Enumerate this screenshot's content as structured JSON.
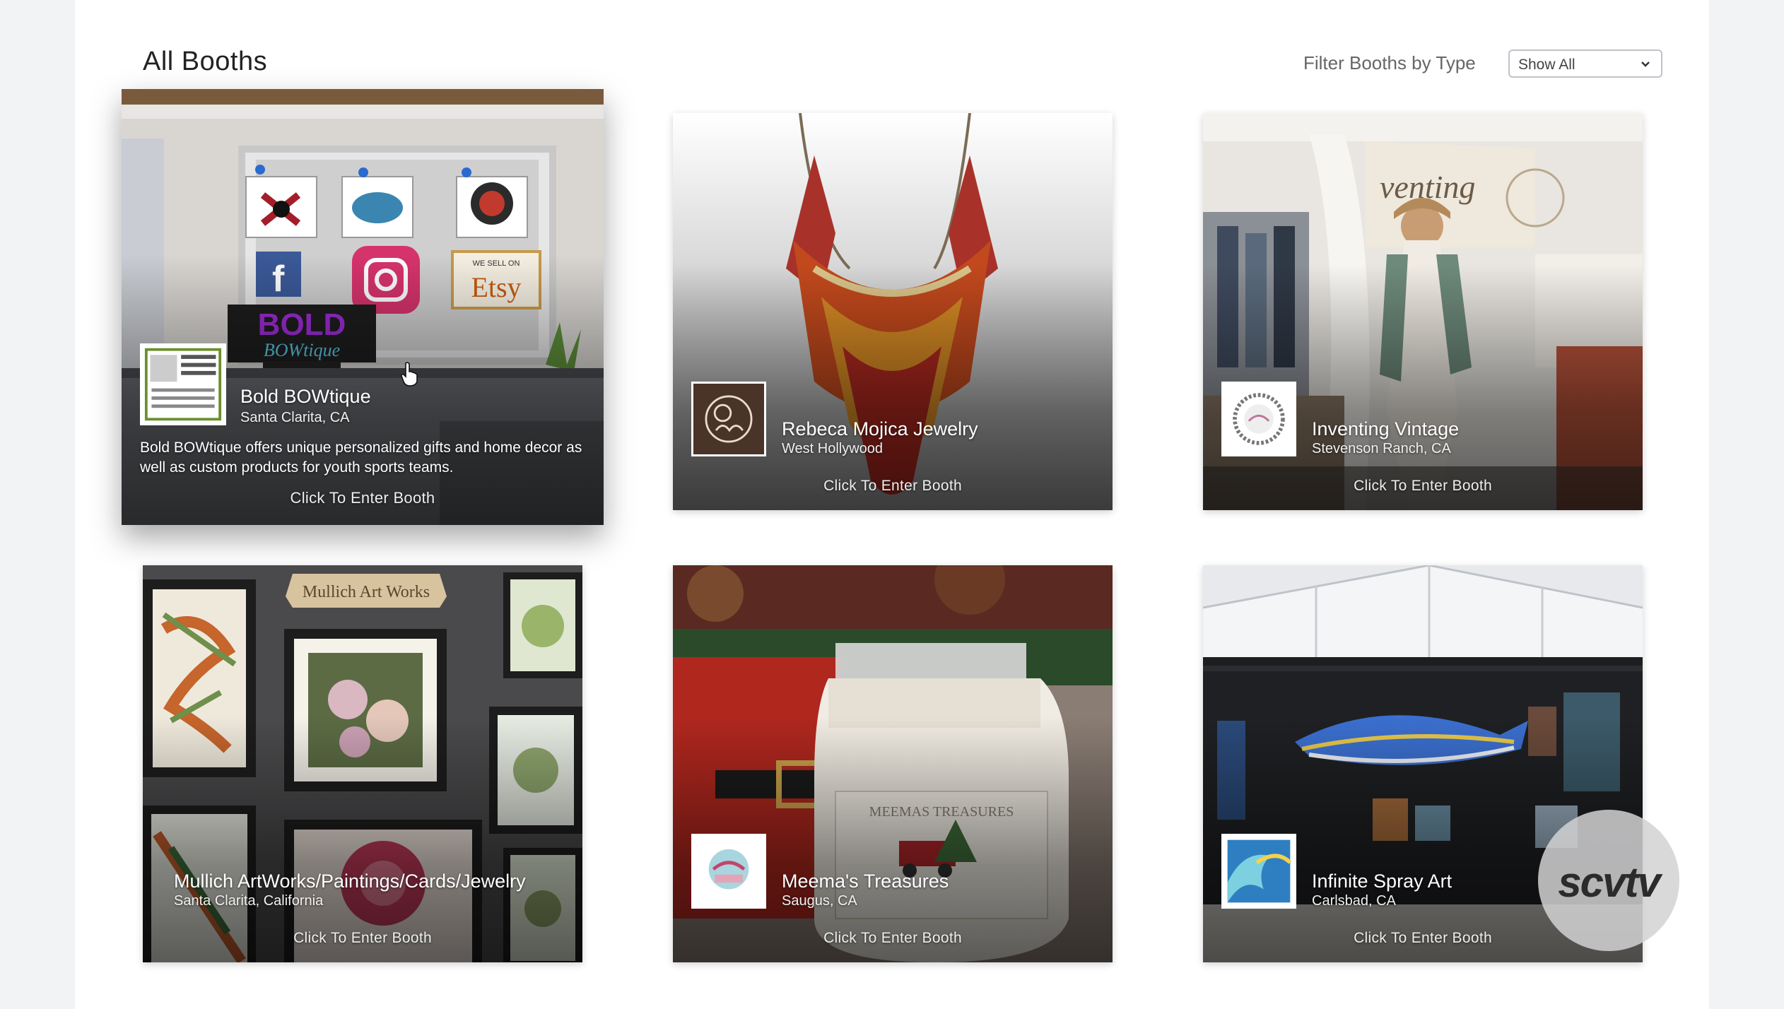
{
  "page": {
    "title": "All Booths",
    "filter_label": "Filter Booths by Type",
    "filter_value": "Show All"
  },
  "booths": [
    {
      "name": "Bold BOWtique",
      "location": "Santa Clarita, CA",
      "description": "Bold BOWtique offers unique personalized gifts and home decor as well as custom products for youth sports teams.",
      "cta": "Click To Enter Booth",
      "logo_texts": [
        "Etsy",
        "WE SELL ON",
        "BOLD",
        "BOWtique"
      ]
    },
    {
      "name": "Rebeca Mojica Jewelry",
      "location": "West Hollywood",
      "cta": "Click To Enter Booth"
    },
    {
      "name": "Inventing Vintage",
      "location": "Stevenson Ranch, CA",
      "cta": "Click To Enter Booth"
    },
    {
      "name": "Mullich ArtWorks/Paintings/Cards/Jewelry",
      "location": "Santa Clarita, California",
      "cta": "Click To Enter Booth",
      "sign_text": "Mullich Art Works"
    },
    {
      "name": "Meema's Treasures",
      "location": "Saugus, CA",
      "cta": "Click To Enter Booth",
      "label_text": "MEEMAS TREASURES"
    },
    {
      "name": "Infinite Spray Art",
      "location": "Carlsbad, CA",
      "cta": "Click To Enter Booth"
    }
  ],
  "watermark": "scvtv",
  "colors": {
    "background": "#f2f3f5",
    "panel": "#ffffff",
    "title": "#222222"
  }
}
